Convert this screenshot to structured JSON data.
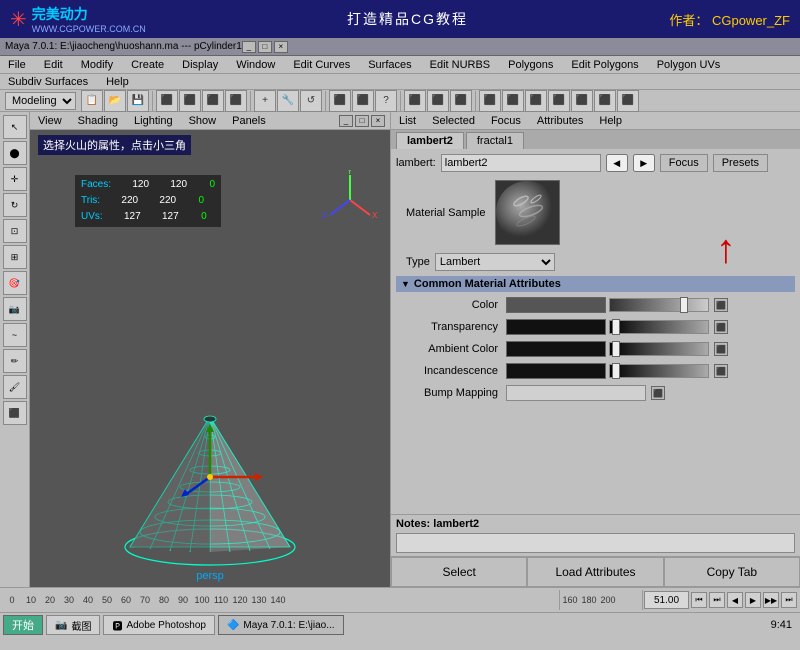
{
  "banner": {
    "logo": "完美动力",
    "website": "WWW.CGPOWER.COM.CN",
    "title": "打造精品CG教程",
    "author_label": "作者：",
    "author_name": "CGpower_ZF"
  },
  "title_bar": {
    "text": "Maya 7.0.1: E:\\jiaocheng\\huoshann.ma   ---   pCylinder1",
    "controls": [
      "-",
      "□",
      "×"
    ]
  },
  "menu": {
    "items": [
      "File",
      "Edit",
      "Modify",
      "Create",
      "Display",
      "Window",
      "Edit Curves",
      "Surfaces",
      "Edit NURBS",
      "Polygons",
      "Edit Polygons",
      "Polygon UVs",
      "Subdiv Surfaces",
      "Help"
    ]
  },
  "toolbar": {
    "mode": "Modeling"
  },
  "viewport": {
    "menu_items": [
      "View",
      "Shading",
      "Lighting",
      "Show",
      "Panels"
    ],
    "label": "选择火山的属性，点击小三角",
    "stats": {
      "faces_label": "Faces:",
      "faces_val1": "120",
      "faces_val2": "120",
      "faces_val3": "0",
      "tris_label": "Tris:",
      "tris_val1": "220",
      "tris_val2": "220",
      "tris_val3": "0",
      "uvs_label": "UVs:",
      "uvs_val1": "127",
      "uvs_val2": "127",
      "uvs_val3": "0"
    },
    "persp_label": "persp"
  },
  "attr_editor": {
    "menu_items": [
      "List",
      "Selected",
      "Focus",
      "Attributes",
      "Help"
    ],
    "tabs": [
      "lambert2",
      "fractal1"
    ],
    "active_tab": "lambert2",
    "lambert_label": "lambert:",
    "lambert_value": "lambert2",
    "focus_btn": "Focus",
    "presets_btn": "Presets",
    "material_sample_label": "Material Sample",
    "type_label": "Type",
    "type_value": "Lambert",
    "section_title": "Common Material Attributes",
    "attributes": [
      {
        "label": "Color",
        "type": "slider"
      },
      {
        "label": "Transparency",
        "type": "slider"
      },
      {
        "label": "Ambient Color",
        "type": "slider"
      },
      {
        "label": "Incandescence",
        "type": "slider"
      },
      {
        "label": "Bump Mapping",
        "type": "input"
      }
    ],
    "notes_label": "Notes: lambert2",
    "notes_value": "",
    "btn_select": "Select",
    "btn_load": "Load Attributes",
    "btn_copy": "Copy Tab"
  },
  "timeline": {
    "numbers": [
      "0",
      "10",
      "20",
      "30",
      "40",
      "50",
      "60",
      "70",
      "80",
      "90",
      "100",
      "110",
      "120",
      "130",
      "140"
    ],
    "numbers2": [
      "160",
      "180",
      "200"
    ],
    "current_frame": "51.00",
    "play_controls": [
      "⏮",
      "⏭",
      "◀",
      "▶",
      "⏯",
      "⏭"
    ]
  },
  "status_bar": {
    "start_btn": "开始",
    "screenshot_item": "截图",
    "photoshop_item": "Adobe Photoshop",
    "maya_item": "Maya 7.0.1: E:\\jiao...",
    "time": "9:41"
  }
}
